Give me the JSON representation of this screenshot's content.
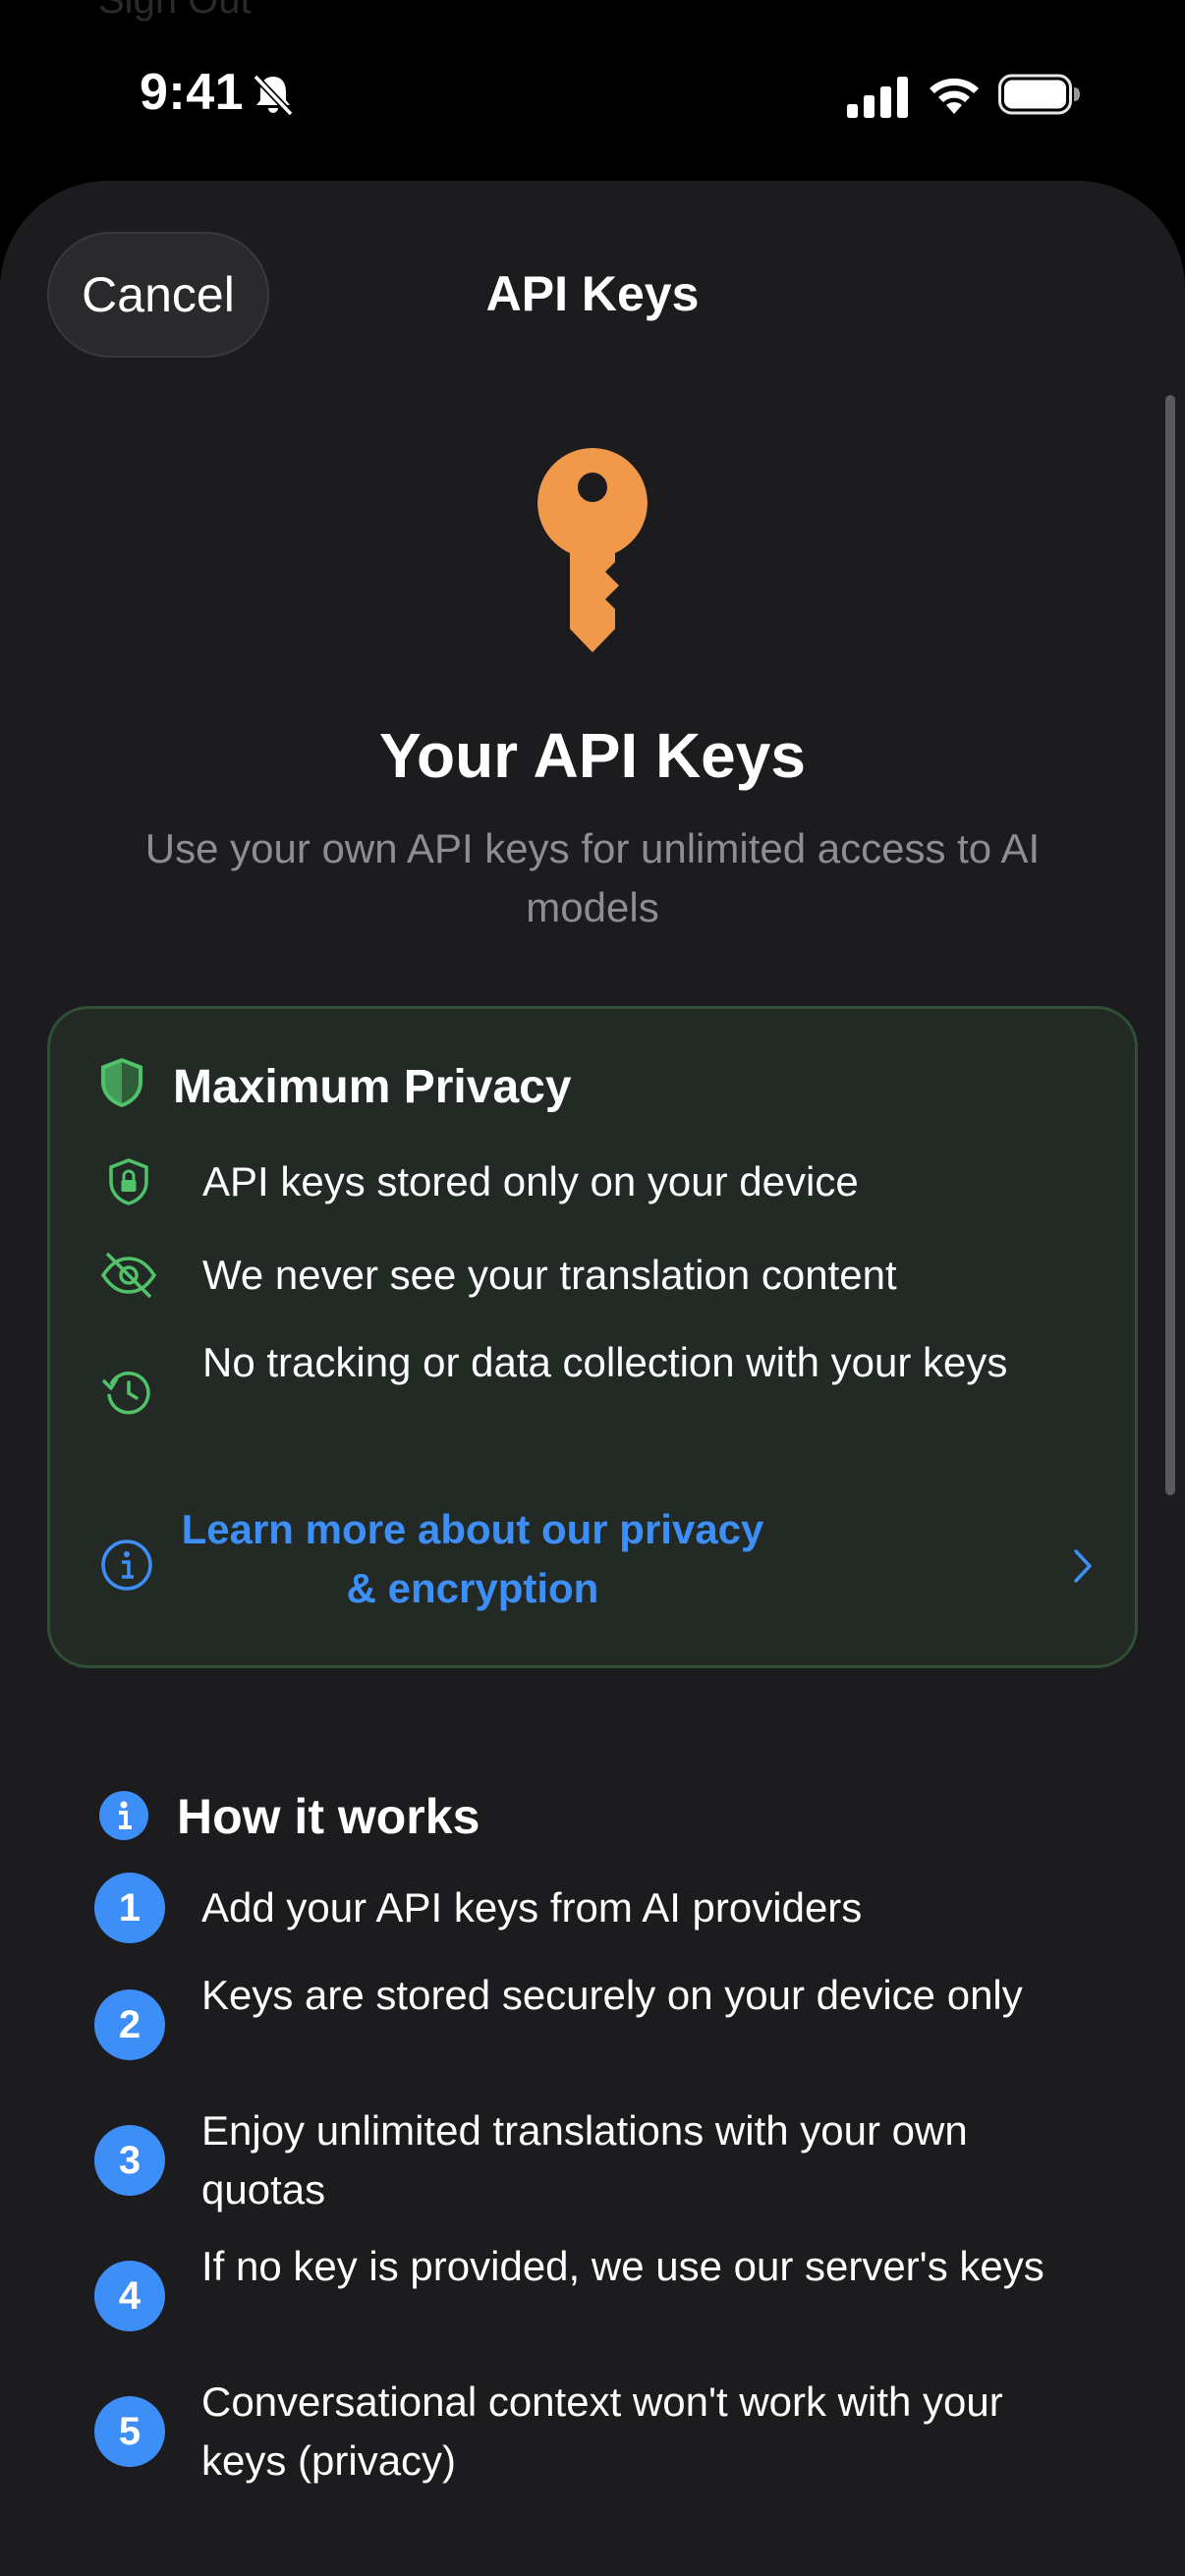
{
  "status_bar": {
    "time": "9:41",
    "icons": [
      "bell-slash-icon",
      "cellular-signal-icon",
      "wifi-icon",
      "battery-icon"
    ]
  },
  "background_text": "Sign Out",
  "nav": {
    "cancel_label": "Cancel",
    "title": "API Keys"
  },
  "hero": {
    "icon": "key-icon",
    "title": "Your API Keys",
    "subtitle": "Use your own API keys for unlimited access to AI models"
  },
  "privacy": {
    "title": "Maximum Privacy",
    "icon": "shield-half-icon",
    "items": [
      {
        "icon": "lock-shield-icon",
        "text": "API keys stored only on your device"
      },
      {
        "icon": "eye-slash-icon",
        "text": "We never see your translation content"
      },
      {
        "icon": "clock-arrow-icon",
        "text": "No tracking or data collection with your keys"
      }
    ],
    "link": {
      "icon": "info-circle-icon",
      "text": "Learn more about our privacy & encryption",
      "chevron": "chevron-right-icon"
    }
  },
  "how_it_works": {
    "title": "How it works",
    "icon": "info-filled-icon",
    "steps": [
      {
        "number": "1",
        "text": "Add your API keys from AI providers"
      },
      {
        "number": "2",
        "text": "Keys are stored securely on your device only"
      },
      {
        "number": "3",
        "text": "Enjoy unlimited translations with your own quotas"
      },
      {
        "number": "4",
        "text": "If no key is provided, we use our server's keys"
      },
      {
        "number": "5",
        "text": "Conversational context won't work with your keys (privacy)"
      }
    ]
  },
  "colors": {
    "accent_blue": "#3e8ef7",
    "key_orange": "#f0994a",
    "privacy_green": "#4fc26a",
    "sheet_bg": "#1c1c1e",
    "card_bg": "#232a25"
  }
}
